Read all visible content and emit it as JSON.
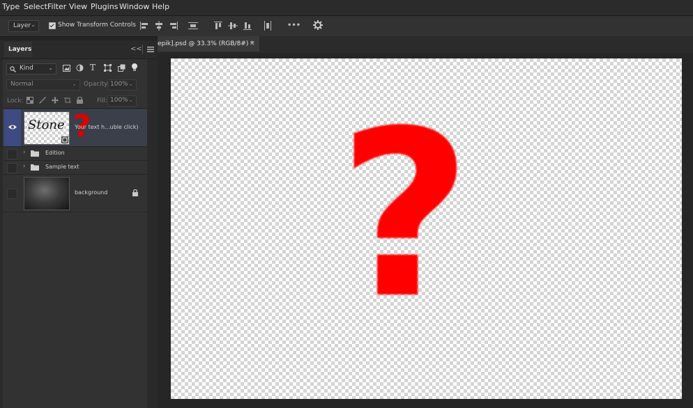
{
  "menu": [
    "Type",
    "Select",
    "Filter",
    "View",
    "Plugins",
    "Window",
    "Help"
  ],
  "options": {
    "auto_select_value": "Layer",
    "show_transform_controls_label": "Show Transform Controls",
    "show_transform_controls_checked": true,
    "more_label": "•••"
  },
  "layers_panel": {
    "tab_label": "Layers",
    "kind_filter": "Kind",
    "blend_mode": "Normal",
    "opacity_label": "Opacity:",
    "opacity_value": "100%",
    "lock_label": "Lock:",
    "fill_label": "Fill:",
    "fill_value": "100%",
    "layers": [
      {
        "name": "Your text h...uble click)",
        "thumb_text": "Stone",
        "thumb_mark": "?",
        "visible": true,
        "selected": true
      },
      {
        "name": "Edition",
        "type": "group"
      },
      {
        "name": "Sample text",
        "type": "group"
      },
      {
        "name": "background",
        "locked": true
      }
    ]
  },
  "document": {
    "tab_title": "epik].psd @ 33.3% (RGB/8#) *",
    "close_glyph": "×",
    "canvas_mark": "?"
  },
  "colors": {
    "accent_red": "#ff0000",
    "selection_blue": "#3e4a82"
  }
}
